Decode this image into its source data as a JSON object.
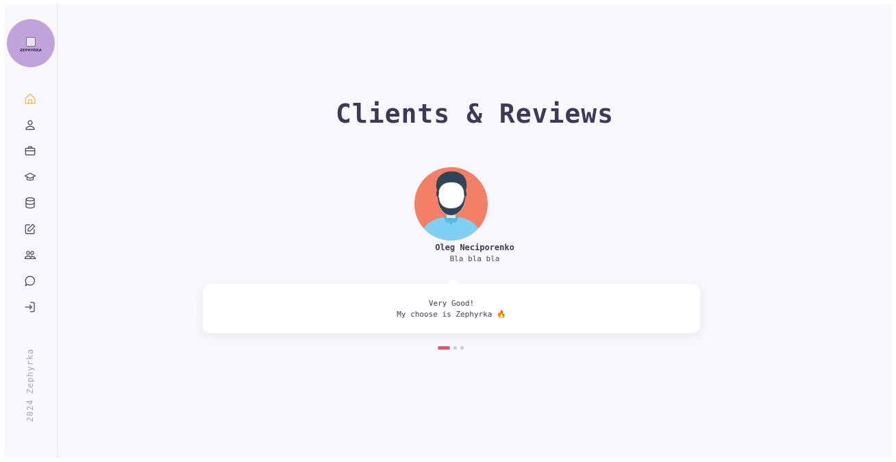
{
  "sidebar": {
    "logo_text": "ZEPHYRKA",
    "nav": [
      {
        "icon": "home-icon",
        "active": true
      },
      {
        "icon": "user-icon",
        "active": false
      },
      {
        "icon": "briefcase-icon",
        "active": false
      },
      {
        "icon": "graduation-cap-icon",
        "active": false
      },
      {
        "icon": "database-icon",
        "active": false
      },
      {
        "icon": "edit-icon",
        "active": false
      },
      {
        "icon": "users-icon",
        "active": false
      },
      {
        "icon": "chat-icon",
        "active": false
      },
      {
        "icon": "sign-in-icon",
        "active": false
      }
    ],
    "copyright": "2024 Zephyrka"
  },
  "main": {
    "title": "Clients & Reviews",
    "review": {
      "name": "Oleg Neciporenko",
      "role": "Bla bla bla",
      "text_line1": "Very Good!",
      "text_line2": "My choose is Zephyrka 🔥"
    },
    "pagination": {
      "total": 3,
      "active": 1
    }
  },
  "colors": {
    "accent": "#f64d6a",
    "active_icon": "#f5b73c",
    "title": "#3d3a56",
    "logo_bg": "#c1a3dc",
    "avatar_bg": "#f47f64",
    "background": "#f8f7fd"
  }
}
